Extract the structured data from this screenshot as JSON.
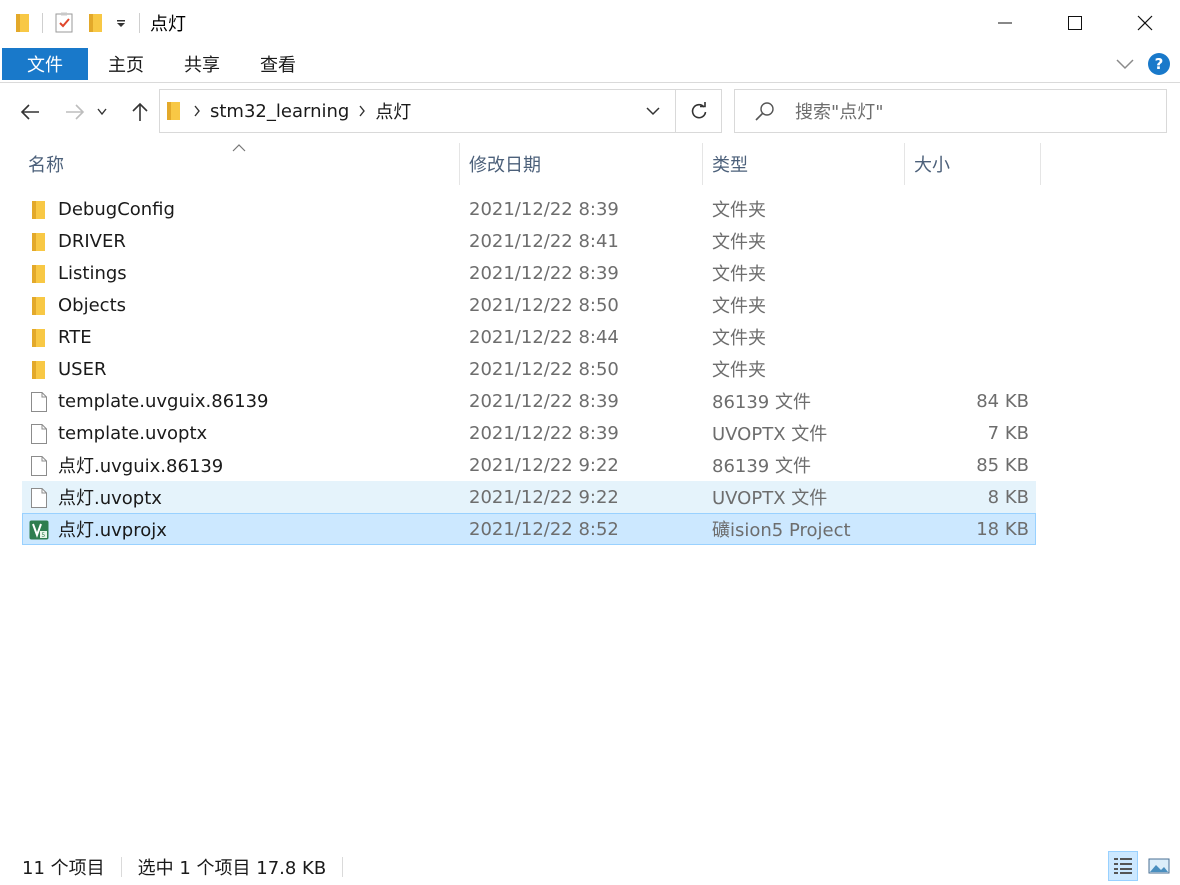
{
  "window": {
    "title": "点灯"
  },
  "ribbon": {
    "tabs": [
      "文件",
      "主页",
      "共享",
      "查看"
    ],
    "help_label": "?"
  },
  "address": {
    "crumbs": [
      "stm32_learning",
      "点灯"
    ]
  },
  "search": {
    "placeholder": "搜索\"点灯\""
  },
  "columns": {
    "name": "名称",
    "date": "修改日期",
    "type": "类型",
    "size": "大小"
  },
  "files": [
    {
      "name": "DebugConfig",
      "date": "2021/12/22 8:39",
      "type": "文件夹",
      "size": "",
      "icon": "folder-icon"
    },
    {
      "name": "DRIVER",
      "date": "2021/12/22 8:41",
      "type": "文件夹",
      "size": "",
      "icon": "folder-icon"
    },
    {
      "name": "Listings",
      "date": "2021/12/22 8:39",
      "type": "文件夹",
      "size": "",
      "icon": "folder-icon"
    },
    {
      "name": "Objects",
      "date": "2021/12/22 8:50",
      "type": "文件夹",
      "size": "",
      "icon": "folder-icon"
    },
    {
      "name": "RTE",
      "date": "2021/12/22 8:44",
      "type": "文件夹",
      "size": "",
      "icon": "folder-icon"
    },
    {
      "name": "USER",
      "date": "2021/12/22 8:50",
      "type": "文件夹",
      "size": "",
      "icon": "folder-icon"
    },
    {
      "name": "template.uvguix.86139",
      "date": "2021/12/22 8:39",
      "type": "86139 文件",
      "size": "84 KB",
      "icon": "file-icon"
    },
    {
      "name": "template.uvoptx",
      "date": "2021/12/22 8:39",
      "type": "UVOPTX 文件",
      "size": "7 KB",
      "icon": "file-icon"
    },
    {
      "name": "点灯.uvguix.86139",
      "date": "2021/12/22 9:22",
      "type": "86139 文件",
      "size": "85 KB",
      "icon": "file-icon"
    },
    {
      "name": "点灯.uvoptx",
      "date": "2021/12/22 9:22",
      "type": "UVOPTX 文件",
      "size": "8 KB",
      "icon": "file-icon",
      "state": "hover"
    },
    {
      "name": "点灯.uvprojx",
      "date": "2021/12/22 8:52",
      "type": "礦ision5 Project",
      "size": "18 KB",
      "icon": "keil-project-icon",
      "state": "selected"
    }
  ],
  "status": {
    "item_count": "11 个项目",
    "selection": "选中 1 个项目  17.8 KB"
  },
  "colors": {
    "accent": "#1979ca",
    "selected_bg": "#cce8ff",
    "hover_bg": "#e5f3fb",
    "folder": "#f8c845"
  }
}
